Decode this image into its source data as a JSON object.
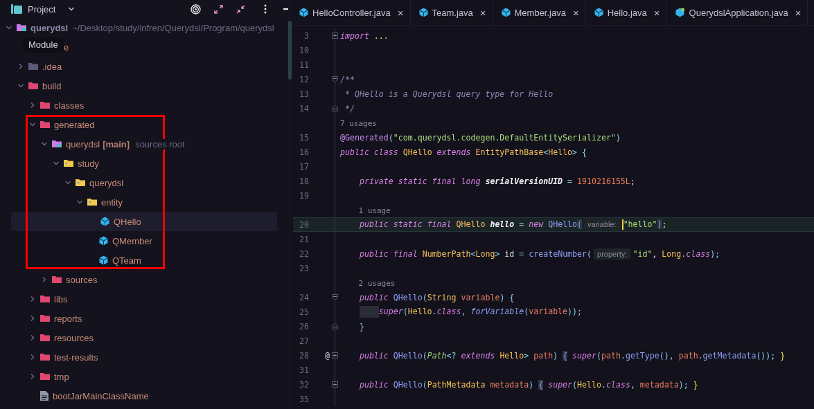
{
  "project_panel": {
    "title": "Project",
    "tooltip": "Module",
    "annotation": {
      "kind": "rectangle"
    },
    "tree": [
      {
        "label": "querydsl",
        "kind": "module",
        "bold": true,
        "path": "~/Desktop/study/infren/Querydsl/Program/querydsl",
        "expanded": true,
        "selected": false,
        "children": [
          {
            "label": "e",
            "partial": true,
            "selected": false
          },
          {
            "label": ".idea",
            "kind": "folder-grey",
            "expanded": false,
            "selected": false
          },
          {
            "label": "build",
            "kind": "folder",
            "expanded": true,
            "selected": false,
            "children": [
              {
                "label": "classes",
                "kind": "folder",
                "expanded": false,
                "selected": false
              },
              {
                "label": "generated",
                "kind": "folder",
                "expanded": true,
                "selected": false,
                "children": [
                  {
                    "label": "querydsl",
                    "tag": "[main]",
                    "hint": "sources root",
                    "kind": "module",
                    "expanded": true,
                    "selected": false,
                    "children": [
                      {
                        "label": "study",
                        "kind": "package",
                        "expanded": true,
                        "selected": false,
                        "children": [
                          {
                            "label": "querydsl",
                            "kind": "package",
                            "expanded": true,
                            "selected": false,
                            "children": [
                              {
                                "label": "entity",
                                "kind": "package",
                                "expanded": true,
                                "selected": false,
                                "children": [
                                  {
                                    "label": "QHello",
                                    "kind": "class",
                                    "selected": true
                                  },
                                  {
                                    "label": "QMember",
                                    "kind": "class",
                                    "selected": false
                                  },
                                  {
                                    "label": "QTeam",
                                    "kind": "class",
                                    "selected": false
                                  }
                                ]
                              }
                            ]
                          }
                        ]
                      }
                    ]
                  },
                  {
                    "label": "sources",
                    "kind": "folder",
                    "expanded": false,
                    "selected": false
                  }
                ]
              },
              {
                "label": "libs",
                "kind": "folder",
                "expanded": false,
                "selected": false
              },
              {
                "label": "reports",
                "kind": "folder",
                "expanded": false,
                "selected": false
              },
              {
                "label": "resources",
                "kind": "folder",
                "expanded": false,
                "selected": false
              },
              {
                "label": "test-results",
                "kind": "folder",
                "expanded": false,
                "selected": false
              },
              {
                "label": "tmp",
                "kind": "folder",
                "expanded": false,
                "selected": false
              },
              {
                "label": "bootJarMainClassName",
                "kind": "file",
                "selected": false
              }
            ]
          }
        ]
      }
    ]
  },
  "editor": {
    "tabs": [
      {
        "label": "HelloController.java",
        "kind": "class",
        "close": "×"
      },
      {
        "label": "Team.java",
        "kind": "class",
        "close": "×"
      },
      {
        "label": "Member.java",
        "kind": "class",
        "close": "×"
      },
      {
        "label": "Hello.java",
        "kind": "class",
        "close": "×"
      },
      {
        "label": "QuerydslApplication.java",
        "kind": "app",
        "close": "×"
      }
    ],
    "lines": [
      {
        "number": "3",
        "fold_marker": {
          "kind": "expand"
        },
        "tokens": [
          {
            "kind": "kw",
            "text": "import"
          },
          {
            "kind": "dim",
            "text": " ..."
          }
        ]
      },
      {
        "number": "10"
      },
      {
        "number": "11"
      },
      {
        "number": "12",
        "fold_marker": {
          "kind": "collapse"
        },
        "tokens": [
          {
            "kind": "cm",
            "text": "/**"
          }
        ]
      },
      {
        "number": "13",
        "tokens": [
          {
            "kind": "cm",
            "text": " * QHello is a Querydsl query type for Hello"
          }
        ]
      },
      {
        "number": "14",
        "fold_marker": {
          "kind": "end"
        },
        "tokens": [
          {
            "kind": "cm",
            "text": " */"
          }
        ]
      },
      {
        "kind": "usage",
        "tokens": [
          {
            "kind": "usage",
            "text": "7 usages"
          }
        ]
      },
      {
        "number": "15",
        "tokens": [
          {
            "kind": "ann",
            "text": "@Generated"
          },
          {
            "kind": "p",
            "text": "("
          },
          {
            "kind": "str",
            "text": "\"com.querydsl.codegen.DefaultEntitySerializer\""
          },
          {
            "kind": "p",
            "text": ")"
          }
        ]
      },
      {
        "number": "16",
        "tokens": [
          {
            "kind": "kw",
            "text": "public class "
          },
          {
            "kind": "ty",
            "text": "QHello"
          },
          {
            "kind": "kw",
            "text": " extends "
          },
          {
            "kind": "ty",
            "text": "EntityPathBase"
          },
          {
            "kind": "p",
            "text": "<"
          },
          {
            "kind": "ty",
            "text": "Hello"
          },
          {
            "kind": "p",
            "text": "> {"
          }
        ]
      },
      {
        "number": "17"
      },
      {
        "number": "18",
        "tokens": [
          {
            "kind": "kw",
            "text": "    private static final long "
          },
          {
            "kind": "sf",
            "text": "serialVersionUID"
          },
          {
            "kind": "p",
            "text": " = "
          },
          {
            "kind": "num",
            "text": "1910216155L"
          },
          {
            "kind": "tx",
            "text": ";"
          }
        ]
      },
      {
        "number": "19"
      },
      {
        "kind": "usage",
        "tokens": [
          {
            "kind": "usage",
            "text": "    1 usage"
          }
        ]
      },
      {
        "number": "20",
        "current": true,
        "tokens": [
          {
            "kind": "kw",
            "text": "    public static final "
          },
          {
            "kind": "ty",
            "text": "QHello "
          },
          {
            "kind": "sf",
            "text": "hello"
          },
          {
            "kind": "p",
            "text": " = "
          },
          {
            "kind": "kw",
            "text": "new "
          },
          {
            "kind": "fn",
            "text": "QHello"
          },
          {
            "kind": "bh",
            "text": "("
          },
          {
            "kind": "hint",
            "text": "variable:"
          },
          {
            "kind": "caret"
          },
          {
            "kind": "str",
            "text": "\"hello\""
          },
          {
            "kind": "bh",
            "text": ")"
          },
          {
            "kind": "tx",
            "text": ";"
          }
        ]
      },
      {
        "number": "21"
      },
      {
        "number": "22",
        "tokens": [
          {
            "kind": "kw",
            "text": "    public final "
          },
          {
            "kind": "ty",
            "text": "NumberPath"
          },
          {
            "kind": "p",
            "text": "<"
          },
          {
            "kind": "ty",
            "text": "Long"
          },
          {
            "kind": "p",
            "text": ">"
          },
          {
            "kind": "tx",
            "text": " id "
          },
          {
            "kind": "p",
            "text": "= "
          },
          {
            "kind": "fn",
            "text": "createNumber"
          },
          {
            "kind": "p",
            "text": "("
          },
          {
            "kind": "hint",
            "text": "property:"
          },
          {
            "kind": "str",
            "text": "\"id\""
          },
          {
            "kind": "tx",
            "text": ", "
          },
          {
            "kind": "ty",
            "text": "Long"
          },
          {
            "kind": "p",
            "text": "."
          },
          {
            "kind": "kw",
            "text": "class"
          },
          {
            "kind": "p",
            "text": ");"
          }
        ]
      },
      {
        "number": "23"
      },
      {
        "kind": "usage",
        "tokens": [
          {
            "kind": "usage",
            "text": "    2 usages"
          }
        ]
      },
      {
        "number": "24",
        "fold_marker": {
          "kind": "collapse"
        },
        "tokens": [
          {
            "kind": "kw",
            "text": "    public "
          },
          {
            "kind": "fn",
            "text": "QHello"
          },
          {
            "kind": "p",
            "text": "("
          },
          {
            "kind": "ty",
            "text": "String "
          },
          {
            "kind": "par",
            "text": "variable"
          },
          {
            "kind": "p",
            "text": ") {"
          }
        ]
      },
      {
        "number": "25",
        "whitespace_highlight": true,
        "tokens": [
          {
            "kind": "kw",
            "text": "super"
          },
          {
            "kind": "p",
            "text": "("
          },
          {
            "kind": "ty",
            "text": "Hello"
          },
          {
            "kind": "p",
            "text": "."
          },
          {
            "kind": "kw",
            "text": "class"
          },
          {
            "kind": "p",
            "text": ", "
          },
          {
            "kind": "fni",
            "text": "forVariable"
          },
          {
            "kind": "p",
            "text": "("
          },
          {
            "kind": "par",
            "text": "variable"
          },
          {
            "kind": "p",
            "text": "));"
          }
        ]
      },
      {
        "number": "26",
        "fold_marker": {
          "kind": "end"
        },
        "tokens": [
          {
            "kind": "p",
            "text": "    }"
          }
        ]
      },
      {
        "number": "27"
      },
      {
        "number": "28",
        "mark": "@",
        "fold_marker": {
          "kind": "expand"
        },
        "tokens": [
          {
            "kind": "kw",
            "text": "    public "
          },
          {
            "kind": "fn",
            "text": "QHello"
          },
          {
            "kind": "p",
            "text": "("
          },
          {
            "kind": "tyi",
            "text": "Path"
          },
          {
            "kind": "p",
            "text": "<? "
          },
          {
            "kind": "kw",
            "text": "extends "
          },
          {
            "kind": "ty",
            "text": "Hello"
          },
          {
            "kind": "p",
            "text": "> "
          },
          {
            "kind": "par",
            "text": "path"
          },
          {
            "kind": "p",
            "text": ") "
          },
          {
            "kind": "bh",
            "text": "{"
          },
          {
            "kind": "kw",
            "text": " super"
          },
          {
            "kind": "p",
            "text": "("
          },
          {
            "kind": "par",
            "text": "path"
          },
          {
            "kind": "p",
            "text": "."
          },
          {
            "kind": "fn",
            "text": "getType"
          },
          {
            "kind": "p",
            "text": "(), "
          },
          {
            "kind": "par",
            "text": "path"
          },
          {
            "kind": "p",
            "text": "."
          },
          {
            "kind": "fn",
            "text": "getMetadata"
          },
          {
            "kind": "p",
            "text": "()); "
          },
          {
            "kind": "yb",
            "text": "}"
          }
        ]
      },
      {
        "number": "31"
      },
      {
        "number": "32",
        "fold_marker": {
          "kind": "expand"
        },
        "tokens": [
          {
            "kind": "kw",
            "text": "    public "
          },
          {
            "kind": "fn",
            "text": "QHello"
          },
          {
            "kind": "p",
            "text": "("
          },
          {
            "kind": "ty",
            "text": "PathMetadata "
          },
          {
            "kind": "par",
            "text": "metadata"
          },
          {
            "kind": "p",
            "text": ") "
          },
          {
            "kind": "bh",
            "text": "{"
          },
          {
            "kind": "kw",
            "text": " super"
          },
          {
            "kind": "p",
            "text": "("
          },
          {
            "kind": "ty",
            "text": "Hello"
          },
          {
            "kind": "p",
            "text": "."
          },
          {
            "kind": "kw",
            "text": "class"
          },
          {
            "kind": "p",
            "text": ", "
          },
          {
            "kind": "par",
            "text": "metadata"
          },
          {
            "kind": "p",
            "text": "); "
          },
          {
            "kind": "yb",
            "text": "}"
          }
        ]
      },
      {
        "number": "35"
      }
    ]
  }
}
